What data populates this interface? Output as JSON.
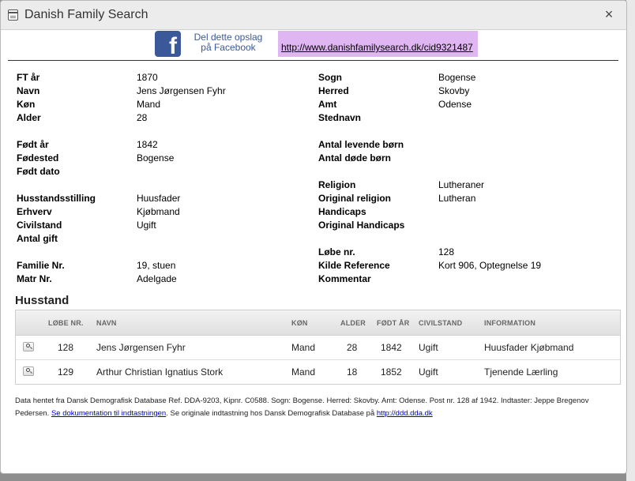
{
  "window": {
    "title": "Danish Family Search",
    "close_label": "×"
  },
  "share": {
    "fb_logo": "f",
    "fb_line1": "Del dette opslag",
    "fb_line2": "på Facebook",
    "link": "http://www.danishfamilysearch.dk/cid9321487"
  },
  "left": [
    {
      "label": "FT år",
      "value": "1870"
    },
    {
      "label": "Navn",
      "value": "Jens Jørgensen Fyhr"
    },
    {
      "label": "Køn",
      "value": "Mand"
    },
    {
      "label": "Alder",
      "value": "28"
    },
    {
      "label": "",
      "value": ""
    },
    {
      "label": "Født år",
      "value": "1842"
    },
    {
      "label": "Fødested",
      "value": "Bogense"
    },
    {
      "label": "Født dato",
      "value": ""
    },
    {
      "label": "",
      "value": ""
    },
    {
      "label": "Husstandsstilling",
      "value": "Huusfader"
    },
    {
      "label": "Erhverv",
      "value": "Kjøbmand"
    },
    {
      "label": "Civilstand",
      "value": "Ugift"
    },
    {
      "label": "Antal gift",
      "value": ""
    },
    {
      "label": "",
      "value": ""
    },
    {
      "label": "Familie Nr.",
      "value": "19, stuen"
    },
    {
      "label": "Matr Nr.",
      "value": "Adelgade"
    }
  ],
  "right": [
    {
      "label": "Sogn",
      "value": "Bogense"
    },
    {
      "label": "Herred",
      "value": "Skovby"
    },
    {
      "label": "Amt",
      "value": "Odense"
    },
    {
      "label": "Stednavn",
      "value": ""
    },
    {
      "label": "",
      "value": ""
    },
    {
      "label": "Antal levende børn",
      "value": ""
    },
    {
      "label": "Antal døde børn",
      "value": ""
    },
    {
      "label": "",
      "value": ""
    },
    {
      "label": "Religion",
      "value": "Lutheraner"
    },
    {
      "label": "Original religion",
      "value": "Lutheran"
    },
    {
      "label": "Handicaps",
      "value": ""
    },
    {
      "label": "Original Handicaps",
      "value": ""
    },
    {
      "label": "",
      "value": ""
    },
    {
      "label": "Løbe nr.",
      "value": "128"
    },
    {
      "label": "Kilde Reference",
      "value": "Kort 906, Optegnelse 19"
    },
    {
      "label": "Kommentar",
      "value": ""
    }
  ],
  "household": {
    "title": "Husstand",
    "headers": {
      "lobe": "LØBE NR.",
      "navn": "NAVN",
      "kon": "KØN",
      "alder": "ALDER",
      "fodt": "FØDT ÅR",
      "civil": "CIVILSTAND",
      "info": "INFORMATION"
    },
    "rows": [
      {
        "lobe": "128",
        "navn": "Jens Jørgensen Fyhr",
        "kon": "Mand",
        "alder": "28",
        "fodt": "1842",
        "civil": "Ugift",
        "info": "Huusfader Kjøbmand"
      },
      {
        "lobe": "129",
        "navn": "Arthur Christian Ignatius Stork",
        "kon": "Mand",
        "alder": "18",
        "fodt": "1852",
        "civil": "Ugift",
        "info": "Tjenende Lærling"
      }
    ]
  },
  "footer": {
    "text1": "Data hentet fra Dansk Demografisk Database Ref. DDA-9203, Kipnr. C0588. Sogn: Bogense. Herred: Skovby. Amt: Odense. Post nr. 128 af 1942. Indtaster: Jeppe Bregenov Pedersen. ",
    "link1": "Se dokumentation til indtastningen",
    "text2": ". Se originale indtastning hos Dansk Demografisk Database på ",
    "link2": "http://ddd.dda.dk"
  }
}
